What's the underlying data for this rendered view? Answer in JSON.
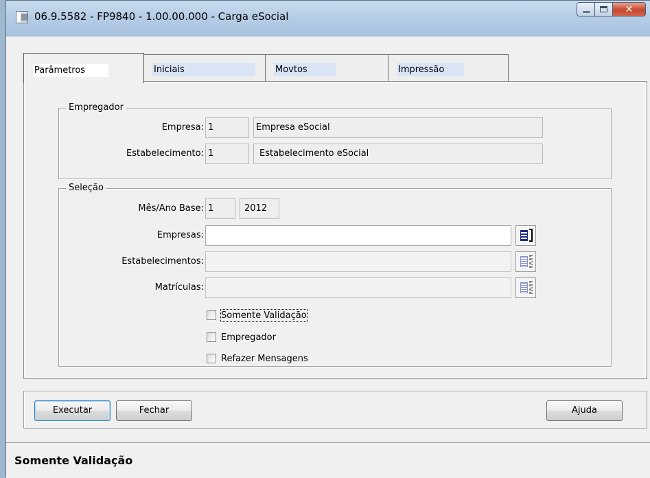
{
  "window": {
    "title": "06.9.5582 - FP9840 - 1.00.00.000 - Carga eSocial"
  },
  "tabs": [
    {
      "label": "Parâmetros",
      "active": true
    },
    {
      "label": "Iniciais",
      "active": false
    },
    {
      "label": "Movtos",
      "active": false
    },
    {
      "label": "Impressão",
      "active": false
    }
  ],
  "empregador": {
    "legend": "Empregador",
    "empresa_label": "Empresa:",
    "empresa_code": "1",
    "empresa_name": "Empresa eSocial",
    "estab_label": "Estabelecimento:",
    "estab_code": "1",
    "estab_name": "Estabelecimento eSocial"
  },
  "selecao": {
    "legend": "Seleção",
    "mes_ano_label": "Mês/Ano Base:",
    "mes": "1",
    "ano": "2012",
    "empresas_label": "Empresas:",
    "empresas_value": "",
    "estabelecimentos_label": "Estabelecimentos:",
    "estabelecimentos_value": "",
    "matriculas_label": "Matrículas:",
    "matriculas_value": ""
  },
  "checkboxes": [
    {
      "label": "Somente Validação",
      "checked": false,
      "focused": true
    },
    {
      "label": "Empregador",
      "checked": false,
      "focused": false
    },
    {
      "label": "Refazer Mensagens",
      "checked": false,
      "focused": false
    }
  ],
  "buttons": {
    "executar": "Executar",
    "fechar": "Fechar",
    "ajuda": "Ajuda"
  },
  "statusbar": {
    "text": "Somente Validação"
  }
}
